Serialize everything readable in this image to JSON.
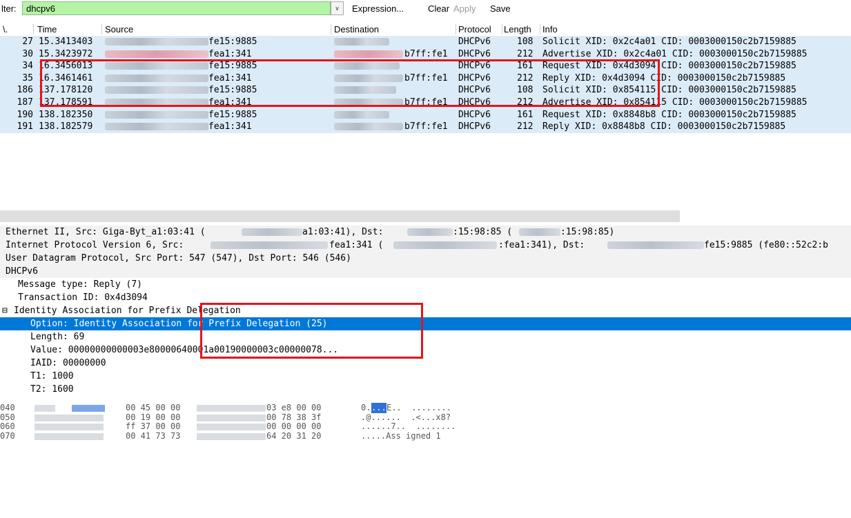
{
  "toolbar": {
    "filter_label": "lter:",
    "filter_value": "dhcpv6",
    "dropdown_glyph": "∨",
    "expression": "Expression...",
    "clear": "Clear",
    "apply": "Apply",
    "save": "Save"
  },
  "packet_list": {
    "columns": [
      "\\.",
      "Time",
      "Source",
      "Destination",
      "Protocol",
      "Length",
      "Info"
    ],
    "rows": [
      {
        "no": "27",
        "time": "15.3413403",
        "src": "fe15:9885",
        "dst": "",
        "proto": "DHCPv6",
        "len": "108",
        "info": "Solicit XID: 0x2c4a01 CID: 0003000150c2b7159885"
      },
      {
        "no": "30",
        "time": "15.3423972",
        "src": "fea1:341",
        "dst": "b7ff:fe1",
        "proto": "DHCPv6",
        "len": "212",
        "info": "Advertise XID: 0x2c4a01 CID: 0003000150c2b7159885"
      },
      {
        "no": "34",
        "time": "16.3456013",
        "src": "fe15:9885",
        "dst": "",
        "proto": "DHCPv6",
        "len": "161",
        "info": "Request XID: 0x4d3094 CID: 0003000150c2b7159885"
      },
      {
        "no": "35",
        "time": "16.3461461",
        "src": "fea1:341",
        "dst": "b7ff:fe1",
        "proto": "DHCPv6",
        "len": "212",
        "info": "Reply XID: 0x4d3094 CID: 0003000150c2b7159885"
      },
      {
        "no": "186",
        "time": "137.178120",
        "src": "fe15:9885",
        "dst": "",
        "proto": "DHCPv6",
        "len": "108",
        "info": "Solicit XID: 0x854115 CID: 0003000150c2b7159885"
      },
      {
        "no": "187",
        "time": "137.178591",
        "src": "fea1:341",
        "dst": "b7ff:fe1",
        "proto": "DHCPv6",
        "len": "212",
        "info": "Advertise XID: 0x854115 CID: 0003000150c2b7159885"
      },
      {
        "no": "190",
        "time": "138.182350",
        "src": "fe15:9885",
        "dst": "",
        "proto": "DHCPv6",
        "len": "161",
        "info": "Request XID: 0x8848b8 CID: 0003000150c2b7159885"
      },
      {
        "no": "191",
        "time": "138.182579",
        "src": "fea1:341",
        "dst": "b7ff:fe1",
        "proto": "DHCPv6",
        "len": "212",
        "info": "Reply XID: 0x8848b8 CID: 0003000150c2b7159885"
      }
    ]
  },
  "details": {
    "ethernet_a": "Ethernet II, Src: Giga-Byt_a1:03:41 (",
    "ethernet_b": "a1:03:41), Dst:",
    "ethernet_c": ":15:98:85 (",
    "ethernet_d": ":15:98:85)",
    "ipv6_a": "Internet Protocol Version 6, Src:",
    "ipv6_b": "fea1:341 (",
    "ipv6_c": ":fea1:341), Dst:",
    "ipv6_d": "fe15:9885 (fe80::52c2:b",
    "udp": "User Datagram Protocol, Src Port: 547 (547), Dst Port: 546 (546)",
    "dhcpv6": "DHCPv6",
    "message_type": "Message type: Reply (7)",
    "transaction_id": "Transaction ID: 0x4d3094",
    "expander": "⊟",
    "ia_pd": "Identity Association for Prefix Delegation",
    "option": "Option: Identity Association for Prefix Delegation (25)",
    "length": "Length: 69",
    "value": "Value: 00000000000003e80000640001a00190000003c00000078...",
    "iaid": "IAID: 00000000",
    "t1": "T1: 1000",
    "t2": "T2: 1600"
  },
  "hexdump": {
    "rows": [
      {
        "offset": "040",
        "mid": "00 45 00 00",
        "right": "03 e8 00 00",
        "ascii_a": "0.",
        "ascii_sel": "...",
        "ascii_b": "E..  ........"
      },
      {
        "offset": "050",
        "mid": "00 19 00 00",
        "right": "00 78 38 3f",
        "ascii_a": ".@......  .<...x8?",
        "ascii_sel": "",
        "ascii_b": ""
      },
      {
        "offset": "060",
        "mid": "ff 37 00 00",
        "right": "00 00 00 00",
        "ascii_a": "......7..  ........",
        "ascii_sel": "",
        "ascii_b": ""
      },
      {
        "offset": "070",
        "mid": "00 41 73 73",
        "right": "64 20 31 20",
        "ascii_a": ".....Ass igned 1",
        "ascii_sel": "",
        "ascii_b": ""
      }
    ]
  },
  "colors": {
    "filter_bg": "#b5f3a6",
    "row_bg": "#dcebf8",
    "selection": "#0078d7",
    "annotation": "#e4141b"
  }
}
